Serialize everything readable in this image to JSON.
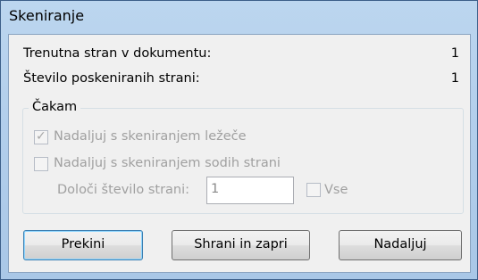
{
  "window": {
    "title": "Skeniranje"
  },
  "info": {
    "current_page_label": "Trenutna stran v dokumentu:",
    "current_page_value": "1",
    "scanned_pages_label": "Število poskeniranih strani:",
    "scanned_pages_value": "1"
  },
  "group": {
    "legend": "Čakam",
    "continue_landscape_label": "Nadaljuj s skeniranjem ležeče",
    "continue_landscape_checked": true,
    "continue_even_label": "Nadaljuj s skeniranjem sodih strani",
    "continue_even_checked": false,
    "page_count_label": "Določi število strani:",
    "page_count_value": "1",
    "all_label": "Vse",
    "all_checked": false
  },
  "buttons": {
    "stop_label": "Prekini",
    "save_close_label": "Shrani in zapri",
    "continue_label": "Nadaljuj"
  }
}
